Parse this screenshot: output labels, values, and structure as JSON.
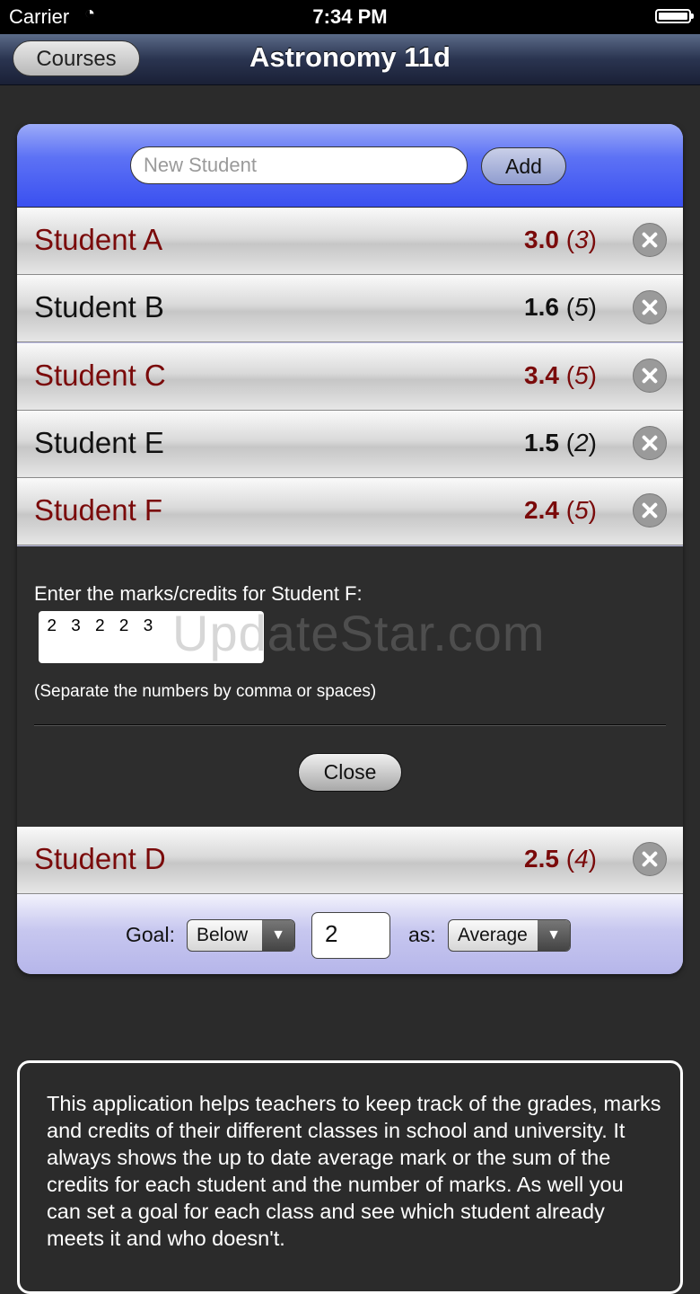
{
  "status_bar": {
    "carrier": "Carrier",
    "time": "7:34 PM"
  },
  "nav": {
    "back_label": "Courses",
    "title": "Astronomy 11d"
  },
  "add_form": {
    "placeholder": "New Student",
    "add_label": "Add"
  },
  "students": [
    {
      "name": "Student A",
      "average": "3.0",
      "count": "3",
      "status": "red"
    },
    {
      "name": "Student B",
      "average": "1.6",
      "count": "5",
      "status": "black"
    },
    {
      "name": "Student C",
      "average": "3.4",
      "count": "5",
      "status": "red"
    },
    {
      "name": "Student E",
      "average": "1.5",
      "count": "2",
      "status": "black"
    },
    {
      "name": "Student F",
      "average": "2.4",
      "count": "5",
      "status": "red"
    }
  ],
  "editor": {
    "prompt": "Enter the marks/credits for Student F:",
    "marks_value": "2 3 2 2 3",
    "hint": "(Separate the numbers by comma or spaces)",
    "close_label": "Close"
  },
  "students_after": [
    {
      "name": "Student D",
      "average": "2.5",
      "count": "4",
      "status": "red"
    }
  ],
  "goal": {
    "label": "Goal:",
    "comparison": "Below",
    "value": "2",
    "as_label": "as:",
    "type": "Average"
  },
  "watermark": "UpdateStar.com",
  "info_text": "This application helps teachers to keep track of the grades, marks and credits of their different classes in school and university. It always shows the up to date average mark or the sum of the credits for each student and the number of marks. As well you can set a goal for each class and see which student already meets it and who doesn't.",
  "colors": {
    "below_goal_text": "#7a0a0a",
    "meets_goal_text": "#111111",
    "header_blue": "#3a50f0"
  }
}
